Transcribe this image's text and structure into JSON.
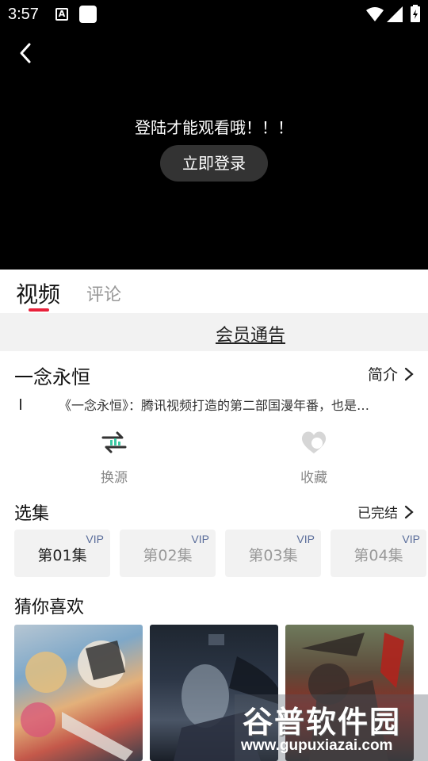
{
  "status_bar": {
    "time": "3:57",
    "notification_letter": "A"
  },
  "player": {
    "login_message": "登陆才能观看哦！！！",
    "login_button": "立即登录"
  },
  "tabs": [
    {
      "label": "视频",
      "active": true
    },
    {
      "label": "评论",
      "active": false
    }
  ],
  "notice": {
    "label": "会员通告"
  },
  "video": {
    "title": "一念永恒",
    "intro_label": "简介",
    "description": "《一念永恒》：腾讯视频打造的第二部国漫年番，也是…"
  },
  "actions": [
    {
      "label": "换源",
      "icon": "switch-source-icon"
    },
    {
      "label": "收藏",
      "icon": "heart-icon"
    }
  ],
  "episodes": {
    "heading": "选集",
    "status": "已完结",
    "items": [
      {
        "label": "第01集",
        "badge": "VIP",
        "current": true
      },
      {
        "label": "第02集",
        "badge": "VIP",
        "current": false
      },
      {
        "label": "第03集",
        "badge": "VIP",
        "current": false
      },
      {
        "label": "第04集",
        "badge": "VIP",
        "current": false
      }
    ]
  },
  "recommend": {
    "heading": "猜你喜欢"
  },
  "watermark": {
    "name": "谷普软件园",
    "url": "www.gupuxiazai.com"
  },
  "colors": {
    "accent": "#e8203a",
    "vip": "#5a6d9a",
    "player_bg": "#000000"
  }
}
